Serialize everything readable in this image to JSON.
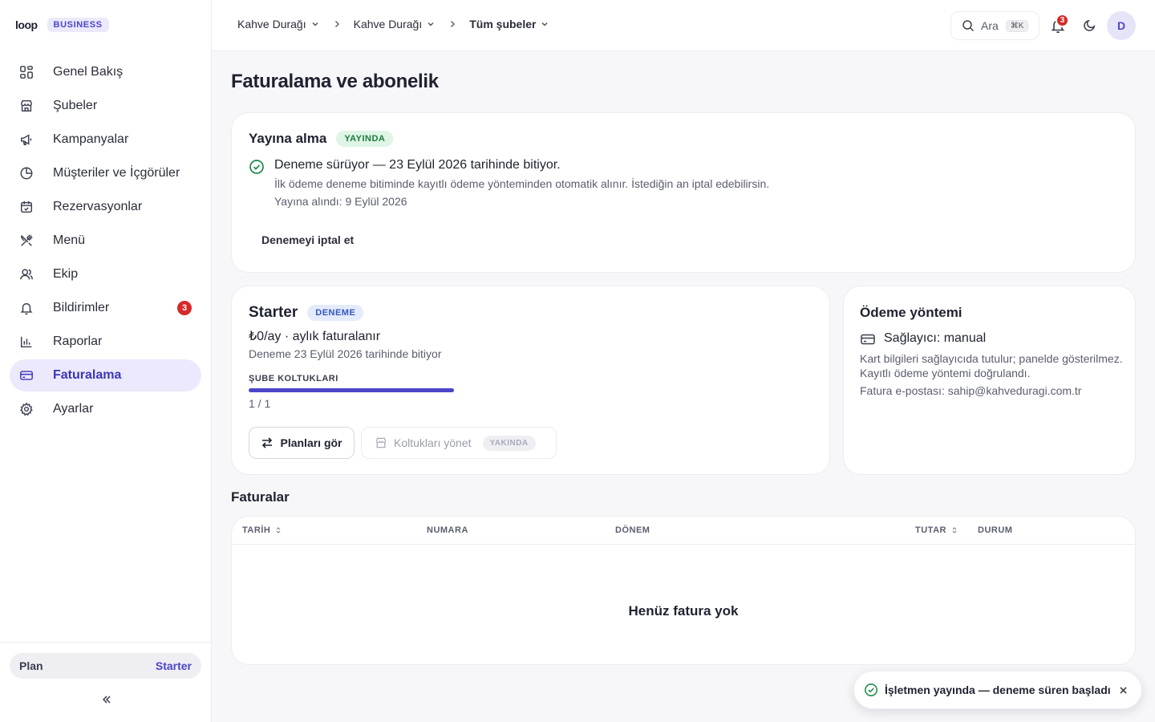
{
  "brand": {
    "logo": "loop",
    "tier": "BUSINESS"
  },
  "sidebar": {
    "items": [
      {
        "label": "Genel Bakış",
        "icon": "grid-icon"
      },
      {
        "label": "Şubeler",
        "icon": "store-icon"
      },
      {
        "label": "Kampanyalar",
        "icon": "megaphone-icon"
      },
      {
        "label": "Müşteriler ve İçgörüler",
        "icon": "pie-chart-icon"
      },
      {
        "label": "Rezervasyonlar",
        "icon": "calendar-icon"
      },
      {
        "label": "Menü",
        "icon": "utensils-icon"
      },
      {
        "label": "Ekip",
        "icon": "users-icon"
      },
      {
        "label": "Bildirimler",
        "icon": "bell-icon",
        "badge": "3"
      },
      {
        "label": "Raporlar",
        "icon": "bar-chart-icon"
      },
      {
        "label": "Faturalama",
        "icon": "credit-card-icon",
        "active": true
      },
      {
        "label": "Ayarlar",
        "icon": "gear-icon"
      }
    ],
    "plan_label": "Plan",
    "plan_value": "Starter"
  },
  "topbar": {
    "breadcrumbs": [
      "Kahve Durağı",
      "Kahve Durağı",
      "Tüm şubeler"
    ],
    "search_label": "Ara",
    "search_shortcut": "⌘K",
    "notifications_count": "3",
    "avatar_initial": "D"
  },
  "page": {
    "title": "Faturalama ve abonelik"
  },
  "publish": {
    "title": "Yayına alma",
    "badge": "YAYINDA",
    "status": "Deneme sürüyor — 23 Eylül 2026 tarihinde bitiyor.",
    "note": "İlk ödeme deneme bitiminde kayıtlı ödeme yönteminden otomatik alınır. İstediğin an iptal edebilirsin.",
    "published": "Yayına alındı: 9 Eylül 2026",
    "cancel_label": "Denemeyi iptal et"
  },
  "plan": {
    "name": "Starter",
    "badge": "DENEME",
    "price": "₺0/ay · aylık faturalanır",
    "trial_note": "Deneme 23 Eylül 2026 tarihinde bitiyor",
    "seats_label": "ŞUBE KOLTUKLARI",
    "seats_used": 1,
    "seats_total": 1,
    "seats_text": "1 / 1",
    "plans_button": "Planları gör",
    "manage_button": "Koltukları yönet",
    "manage_badge": "YAKINDA"
  },
  "payment": {
    "title": "Ödeme yöntemi",
    "provider": "Sağlayıcı: manual",
    "line1": "Kart bilgileri sağlayıcıda tutulur; panelde gösterilmez.",
    "line2": "Kayıtlı ödeme yöntemi doğrulandı.",
    "line3": "Fatura e-postası: sahip@kahveduragi.com.tr"
  },
  "invoices": {
    "title": "Faturalar",
    "columns": [
      "TARİH",
      "NUMARA",
      "DÖNEM",
      "TUTAR",
      "DURUM"
    ],
    "empty": "Henüz fatura yok"
  },
  "toast": {
    "message": "İşletmen yayında — deneme süren başladı"
  },
  "colors": {
    "accent": "#4c45c8",
    "success": "#1c8a45",
    "danger": "#d62929"
  }
}
